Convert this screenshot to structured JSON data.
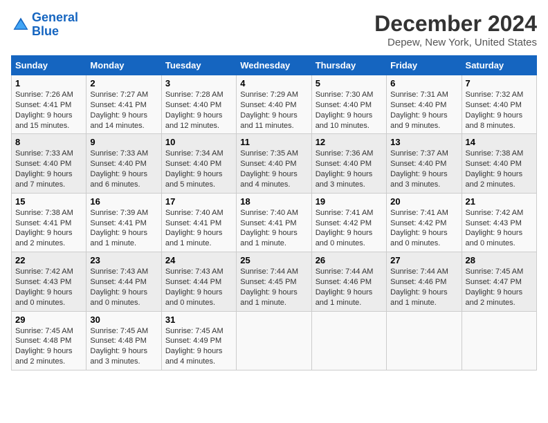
{
  "header": {
    "logo_line1": "General",
    "logo_line2": "Blue",
    "title": "December 2024",
    "subtitle": "Depew, New York, United States"
  },
  "columns": [
    "Sunday",
    "Monday",
    "Tuesday",
    "Wednesday",
    "Thursday",
    "Friday",
    "Saturday"
  ],
  "weeks": [
    [
      {
        "day": "1",
        "info": "Sunrise: 7:26 AM\nSunset: 4:41 PM\nDaylight: 9 hours and 15 minutes."
      },
      {
        "day": "2",
        "info": "Sunrise: 7:27 AM\nSunset: 4:41 PM\nDaylight: 9 hours and 14 minutes."
      },
      {
        "day": "3",
        "info": "Sunrise: 7:28 AM\nSunset: 4:40 PM\nDaylight: 9 hours and 12 minutes."
      },
      {
        "day": "4",
        "info": "Sunrise: 7:29 AM\nSunset: 4:40 PM\nDaylight: 9 hours and 11 minutes."
      },
      {
        "day": "5",
        "info": "Sunrise: 7:30 AM\nSunset: 4:40 PM\nDaylight: 9 hours and 10 minutes."
      },
      {
        "day": "6",
        "info": "Sunrise: 7:31 AM\nSunset: 4:40 PM\nDaylight: 9 hours and 9 minutes."
      },
      {
        "day": "7",
        "info": "Sunrise: 7:32 AM\nSunset: 4:40 PM\nDaylight: 9 hours and 8 minutes."
      }
    ],
    [
      {
        "day": "8",
        "info": "Sunrise: 7:33 AM\nSunset: 4:40 PM\nDaylight: 9 hours and 7 minutes."
      },
      {
        "day": "9",
        "info": "Sunrise: 7:33 AM\nSunset: 4:40 PM\nDaylight: 9 hours and 6 minutes."
      },
      {
        "day": "10",
        "info": "Sunrise: 7:34 AM\nSunset: 4:40 PM\nDaylight: 9 hours and 5 minutes."
      },
      {
        "day": "11",
        "info": "Sunrise: 7:35 AM\nSunset: 4:40 PM\nDaylight: 9 hours and 4 minutes."
      },
      {
        "day": "12",
        "info": "Sunrise: 7:36 AM\nSunset: 4:40 PM\nDaylight: 9 hours and 3 minutes."
      },
      {
        "day": "13",
        "info": "Sunrise: 7:37 AM\nSunset: 4:40 PM\nDaylight: 9 hours and 3 minutes."
      },
      {
        "day": "14",
        "info": "Sunrise: 7:38 AM\nSunset: 4:40 PM\nDaylight: 9 hours and 2 minutes."
      }
    ],
    [
      {
        "day": "15",
        "info": "Sunrise: 7:38 AM\nSunset: 4:41 PM\nDaylight: 9 hours and 2 minutes."
      },
      {
        "day": "16",
        "info": "Sunrise: 7:39 AM\nSunset: 4:41 PM\nDaylight: 9 hours and 1 minute."
      },
      {
        "day": "17",
        "info": "Sunrise: 7:40 AM\nSunset: 4:41 PM\nDaylight: 9 hours and 1 minute."
      },
      {
        "day": "18",
        "info": "Sunrise: 7:40 AM\nSunset: 4:41 PM\nDaylight: 9 hours and 1 minute."
      },
      {
        "day": "19",
        "info": "Sunrise: 7:41 AM\nSunset: 4:42 PM\nDaylight: 9 hours and 0 minutes."
      },
      {
        "day": "20",
        "info": "Sunrise: 7:41 AM\nSunset: 4:42 PM\nDaylight: 9 hours and 0 minutes."
      },
      {
        "day": "21",
        "info": "Sunrise: 7:42 AM\nSunset: 4:43 PM\nDaylight: 9 hours and 0 minutes."
      }
    ],
    [
      {
        "day": "22",
        "info": "Sunrise: 7:42 AM\nSunset: 4:43 PM\nDaylight: 9 hours and 0 minutes."
      },
      {
        "day": "23",
        "info": "Sunrise: 7:43 AM\nSunset: 4:44 PM\nDaylight: 9 hours and 0 minutes."
      },
      {
        "day": "24",
        "info": "Sunrise: 7:43 AM\nSunset: 4:44 PM\nDaylight: 9 hours and 0 minutes."
      },
      {
        "day": "25",
        "info": "Sunrise: 7:44 AM\nSunset: 4:45 PM\nDaylight: 9 hours and 1 minute."
      },
      {
        "day": "26",
        "info": "Sunrise: 7:44 AM\nSunset: 4:46 PM\nDaylight: 9 hours and 1 minute."
      },
      {
        "day": "27",
        "info": "Sunrise: 7:44 AM\nSunset: 4:46 PM\nDaylight: 9 hours and 1 minute."
      },
      {
        "day": "28",
        "info": "Sunrise: 7:45 AM\nSunset: 4:47 PM\nDaylight: 9 hours and 2 minutes."
      }
    ],
    [
      {
        "day": "29",
        "info": "Sunrise: 7:45 AM\nSunset: 4:48 PM\nDaylight: 9 hours and 2 minutes."
      },
      {
        "day": "30",
        "info": "Sunrise: 7:45 AM\nSunset: 4:48 PM\nDaylight: 9 hours and 3 minutes."
      },
      {
        "day": "31",
        "info": "Sunrise: 7:45 AM\nSunset: 4:49 PM\nDaylight: 9 hours and 4 minutes."
      },
      null,
      null,
      null,
      null
    ]
  ]
}
